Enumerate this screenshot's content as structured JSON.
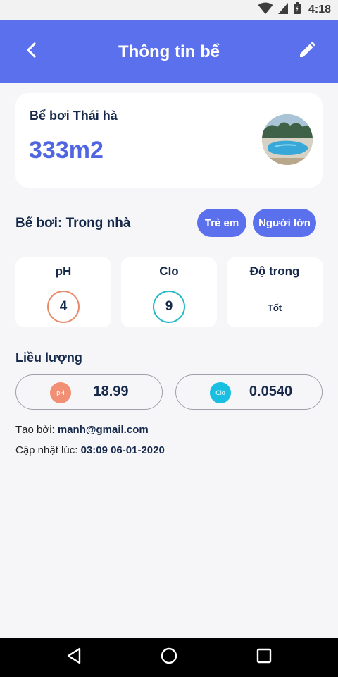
{
  "status_bar": {
    "time": "4:18"
  },
  "header": {
    "title": "Thông tin bể"
  },
  "pool": {
    "name": "Bể bơi Thái hà",
    "area": "333m2"
  },
  "pool_type": {
    "label": "Bể bơi:",
    "value": "Trong nhà"
  },
  "audience_tags": [
    "Trẻ em",
    "Người lớn"
  ],
  "metrics": [
    {
      "title": "pH",
      "value": "4",
      "ring_color": "#e98a6a"
    },
    {
      "title": "Clo",
      "value": "9",
      "ring_color": "#22b8c8"
    },
    {
      "title": "Độ trong",
      "value": "Tốt"
    }
  ],
  "dosage": {
    "title": "Liều lượng",
    "items": [
      {
        "badge": "pH",
        "value": "18.99",
        "badge_color": "#f08f74"
      },
      {
        "badge": "Clo",
        "value": "0.0540",
        "badge_color": "#18bfe0"
      }
    ]
  },
  "meta": {
    "created_label": "Tạo bởi:",
    "created_by": "manh@gmail.com",
    "updated_label": "Cập nhật lúc:",
    "updated_at": "03:09 06-01-2020"
  },
  "icons": {
    "back": "back-arrow-icon",
    "edit": "pencil-icon",
    "nav_back": "triangle-back-icon",
    "nav_home": "circle-home-icon",
    "nav_recents": "square-recents-icon"
  }
}
